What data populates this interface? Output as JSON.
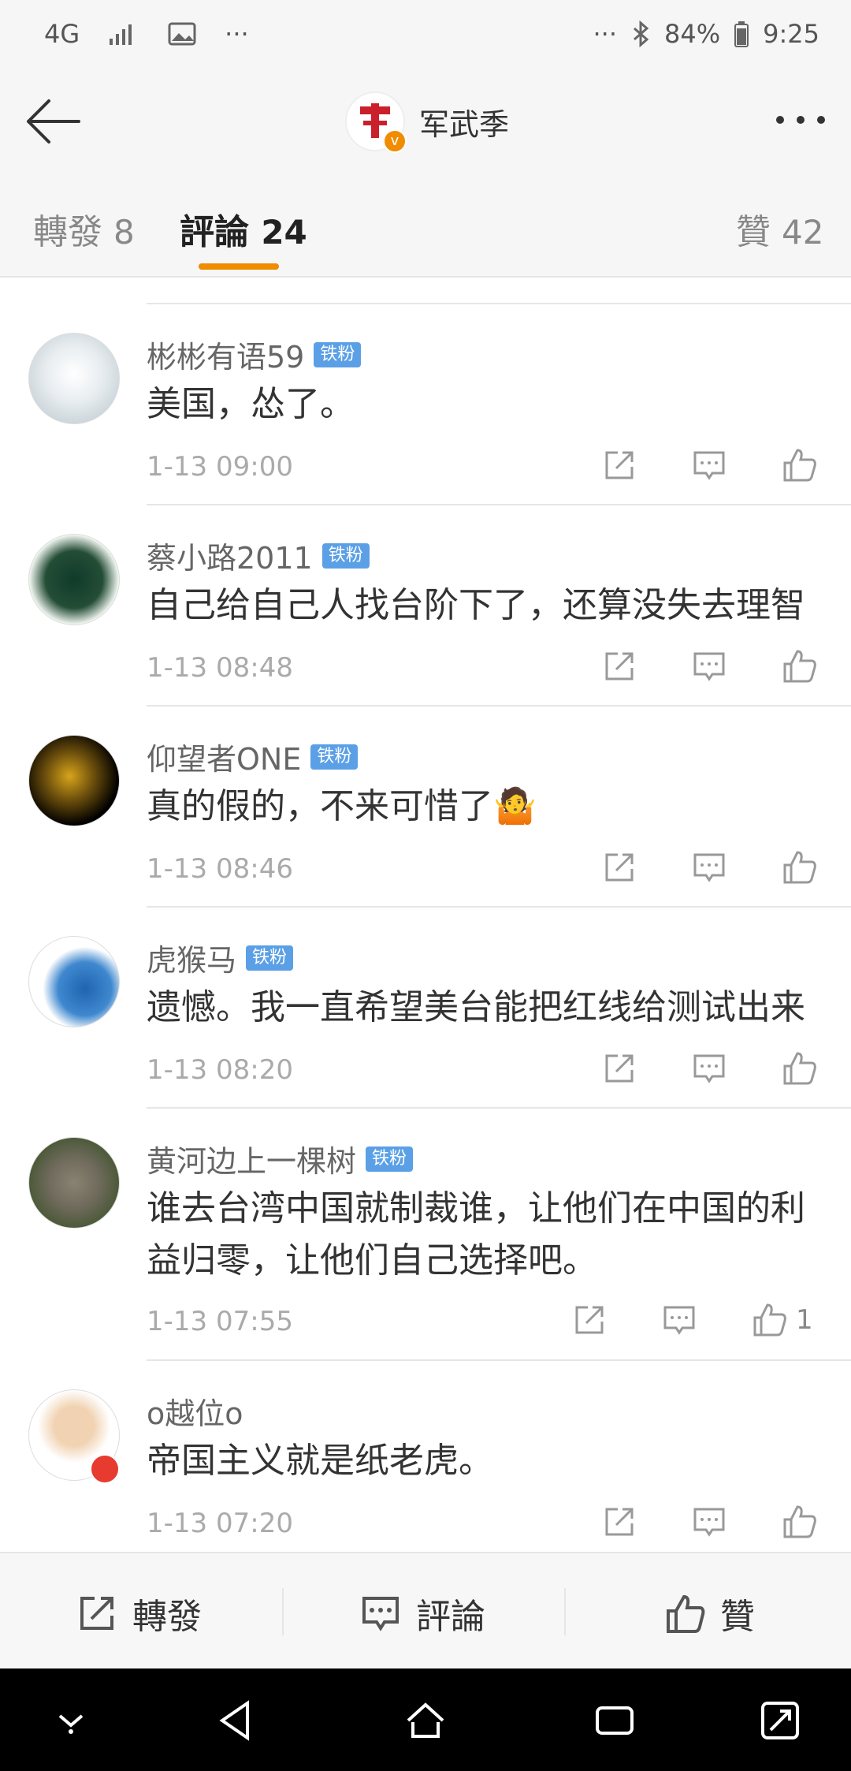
{
  "status": {
    "network": "4G",
    "dots": "···",
    "battery_percent": "84%",
    "time": "9:25"
  },
  "header": {
    "title": "军武季"
  },
  "tabs": [
    {
      "label": "轉發",
      "count": "8"
    },
    {
      "label": "評論",
      "count": "24"
    },
    {
      "label": "贊",
      "count": "42"
    }
  ],
  "comments": [
    {
      "user": "彬彬有语59",
      "badge": "铁粉",
      "text": "美国，怂了。",
      "time": "1-13 09:00",
      "likes": ""
    },
    {
      "user": "蔡小路2011",
      "badge": "铁粉",
      "text": "自己给自己人找台阶下了，还算没失去理智",
      "time": "1-13 08:48",
      "likes": ""
    },
    {
      "user": "仰望者ONE",
      "badge": "铁粉",
      "text": "真的假的，不来可惜了🤷",
      "time": "1-13 08:46",
      "likes": ""
    },
    {
      "user": "虎猴马",
      "badge": "铁粉",
      "text": "遗憾。我一直希望美台能把红线给测试出来",
      "time": "1-13 08:20",
      "likes": ""
    },
    {
      "user": "黄河边上一棵树",
      "badge": "铁粉",
      "text": "谁去台湾中国就制裁谁，让他们在中国的利益归零，让他们自己选择吧。",
      "time": "1-13 07:55",
      "likes": "1"
    },
    {
      "user": "o越位o",
      "badge": "",
      "text": "帝国主义就是纸老虎。",
      "time": "1-13 07:20",
      "likes": ""
    }
  ],
  "bottom_bar": {
    "repost": "轉發",
    "comment": "評論",
    "like": "贊"
  },
  "colors": {
    "accent": "#f08c00",
    "badge": "#5ba0e6",
    "bg": "#f6f6f6"
  }
}
